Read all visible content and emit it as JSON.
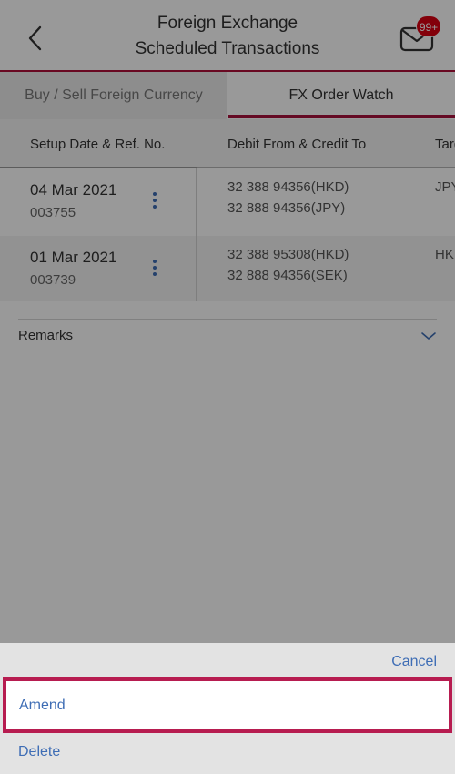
{
  "header": {
    "title_line1": "Foreign Exchange",
    "title_line2": "Scheduled Transactions",
    "badge": "99+"
  },
  "tabs": [
    {
      "label": "Buy / Sell Foreign Currency",
      "selected": false
    },
    {
      "label": "FX Order Watch",
      "selected": true
    }
  ],
  "table": {
    "columns": [
      "Setup Date & Ref. No.",
      "Debit From & Credit To",
      "Target"
    ],
    "rows": [
      {
        "date": "04 Mar 2021",
        "ref": "003755",
        "debit": "32 388 94356(HKD)",
        "credit": "32 888 94356(JPY)",
        "target": "JPY"
      },
      {
        "date": "01 Mar 2021",
        "ref": "003739",
        "debit": "32 388 95308(HKD)",
        "credit": "32 888 94356(SEK)",
        "target": "HKD"
      }
    ]
  },
  "remarks": {
    "label": "Remarks"
  },
  "action_sheet": {
    "cancel_label": "Cancel",
    "items": [
      {
        "label": "Amend",
        "highlighted": true
      },
      {
        "label": "Delete",
        "highlighted": false
      }
    ]
  },
  "colors": {
    "accent": "#a8123c",
    "link": "#3e6db5",
    "badge": "#db0011"
  },
  "icons": [
    "back-chevron-icon",
    "mail-icon",
    "kebab-menu-icon",
    "chevron-down-icon"
  ]
}
